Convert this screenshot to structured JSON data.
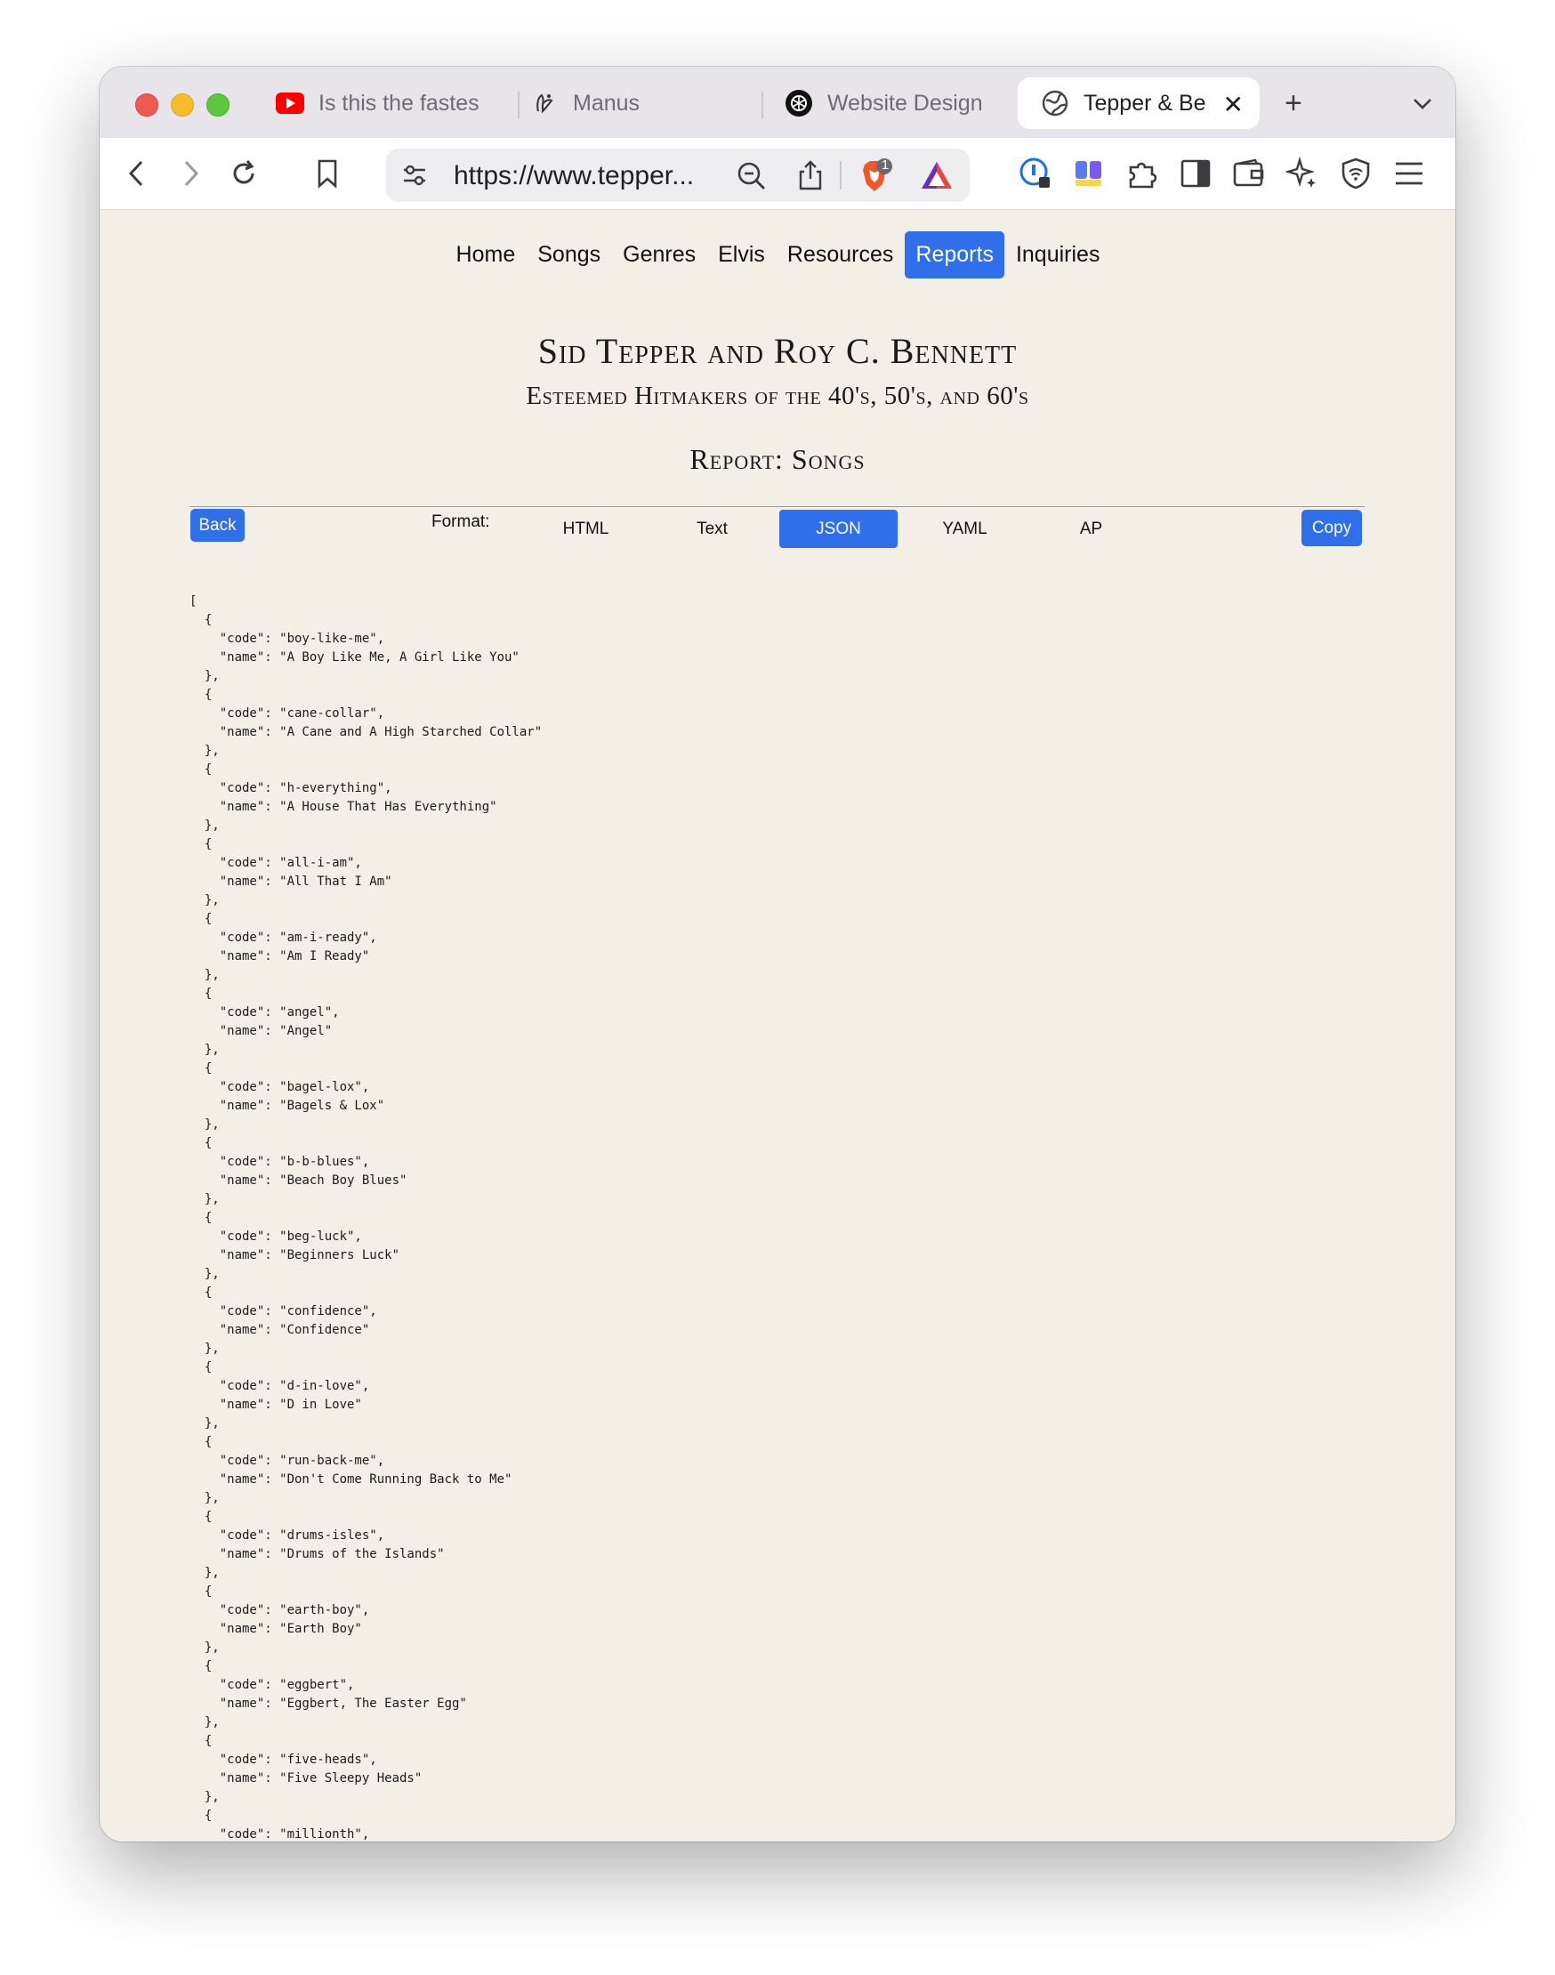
{
  "browser": {
    "tabs": [
      {
        "label": "Is this the fastes",
        "icon": "youtube-icon"
      },
      {
        "label": "Manus",
        "icon": "manus-icon"
      },
      {
        "label": "Website Design",
        "icon": "openai-icon"
      },
      {
        "label": "Tepper & Be",
        "icon": "globe-icon",
        "active": true
      }
    ],
    "close_glyph": "✕",
    "newtab_glyph": "+",
    "tabmenu_glyph": "⌄",
    "url": "https://www.tepper...",
    "brave_badge": "1"
  },
  "nav": {
    "items": [
      "Home",
      "Songs",
      "Genres",
      "Elvis",
      "Resources",
      "Reports",
      "Inquiries"
    ],
    "active": "Reports"
  },
  "header": {
    "title": "Sid Tepper and Roy C. Bennett",
    "subtitle": "Esteemed Hitmakers of the 40's, 50's, and 60's",
    "report_title": "Report: Songs"
  },
  "controls": {
    "back_label": "Back",
    "format_label": "Format:",
    "formats": [
      "HTML",
      "Text",
      "JSON",
      "YAML",
      "AP"
    ],
    "active_format": "JSON",
    "copy_label": "Copy"
  },
  "songs": [
    {
      "code": "boy-like-me",
      "name": "A Boy Like Me, A Girl Like You"
    },
    {
      "code": "cane-collar",
      "name": "A Cane and A High Starched Collar"
    },
    {
      "code": "h-everything",
      "name": "A House That Has Everything"
    },
    {
      "code": "all-i-am",
      "name": "All That I Am"
    },
    {
      "code": "am-i-ready",
      "name": "Am I Ready"
    },
    {
      "code": "angel",
      "name": "Angel"
    },
    {
      "code": "bagel-lox",
      "name": "Bagels & Lox"
    },
    {
      "code": "b-b-blues",
      "name": "Beach Boy Blues"
    },
    {
      "code": "beg-luck",
      "name": "Beginners Luck"
    },
    {
      "code": "confidence",
      "name": "Confidence"
    },
    {
      "code": "d-in-love",
      "name": "D in Love"
    },
    {
      "code": "run-back-me",
      "name": "Don't Come Running Back to Me"
    },
    {
      "code": "drums-isles",
      "name": "Drums of the Islands"
    },
    {
      "code": "earth-boy",
      "name": "Earth Boy"
    },
    {
      "code": "eggbert",
      "name": "Eggbert, The Easter Egg"
    },
    {
      "code": "five-heads",
      "name": "Five Sleepy Heads"
    },
    {
      "code": "millionth",
      "name": ""
    }
  ],
  "colors": {
    "accent": "#2f6fe9",
    "page_background": "#f3efe7"
  }
}
